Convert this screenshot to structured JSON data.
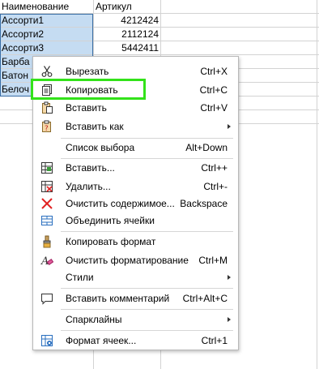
{
  "sheet": {
    "headers": [
      "Наименование",
      "Артикул"
    ],
    "rows": [
      {
        "name": "Ассорти1",
        "article": "4212424"
      },
      {
        "name": "Ассорти2",
        "article": "2112124"
      },
      {
        "name": "Ассорти3",
        "article": "5442411"
      },
      {
        "name": "Барба",
        "article": ""
      },
      {
        "name": "Батон",
        "article": ""
      },
      {
        "name": "Белоч",
        "article": ""
      }
    ]
  },
  "menu": {
    "items": [
      {
        "label": "Вырезать",
        "shortcut": "Ctrl+X",
        "icon": "scissors-icon"
      },
      {
        "label": "Копировать",
        "shortcut": "Ctrl+C",
        "icon": "copy-icon"
      },
      {
        "label": "Вставить",
        "shortcut": "Ctrl+V",
        "icon": "paste-icon"
      },
      {
        "label": "Вставить как",
        "shortcut": "",
        "icon": "paste-special-icon"
      },
      {
        "label": "Список выбора",
        "shortcut": "Alt+Down",
        "icon": ""
      },
      {
        "label": "Вставить...",
        "shortcut": "Ctrl++",
        "icon": "insert-cells-icon"
      },
      {
        "label": "Удалить...",
        "shortcut": "Ctrl+-",
        "icon": "delete-cells-icon"
      },
      {
        "label": "Очистить содержимое...",
        "shortcut": "Backspace",
        "icon": "clear-icon"
      },
      {
        "label": "Объединить ячейки",
        "shortcut": "",
        "icon": "merge-cells-icon"
      },
      {
        "label": "Копировать формат",
        "shortcut": "",
        "icon": "format-paintbrush-icon"
      },
      {
        "label": "Очистить форматирование",
        "shortcut": "Ctrl+M",
        "icon": "clear-formatting-icon"
      },
      {
        "label": "Стили",
        "shortcut": "",
        "icon": ""
      },
      {
        "label": "Вставить комментарий",
        "shortcut": "Ctrl+Alt+C",
        "icon": "comment-icon"
      },
      {
        "label": "Спарклайны",
        "shortcut": "",
        "icon": ""
      },
      {
        "label": "Формат ячеек...",
        "shortcut": "Ctrl+1",
        "icon": "format-cells-icon"
      }
    ]
  },
  "colors": {
    "selection": "#c5dcf2",
    "highlight": "#33e21a",
    "delete_red": "#e02020"
  }
}
